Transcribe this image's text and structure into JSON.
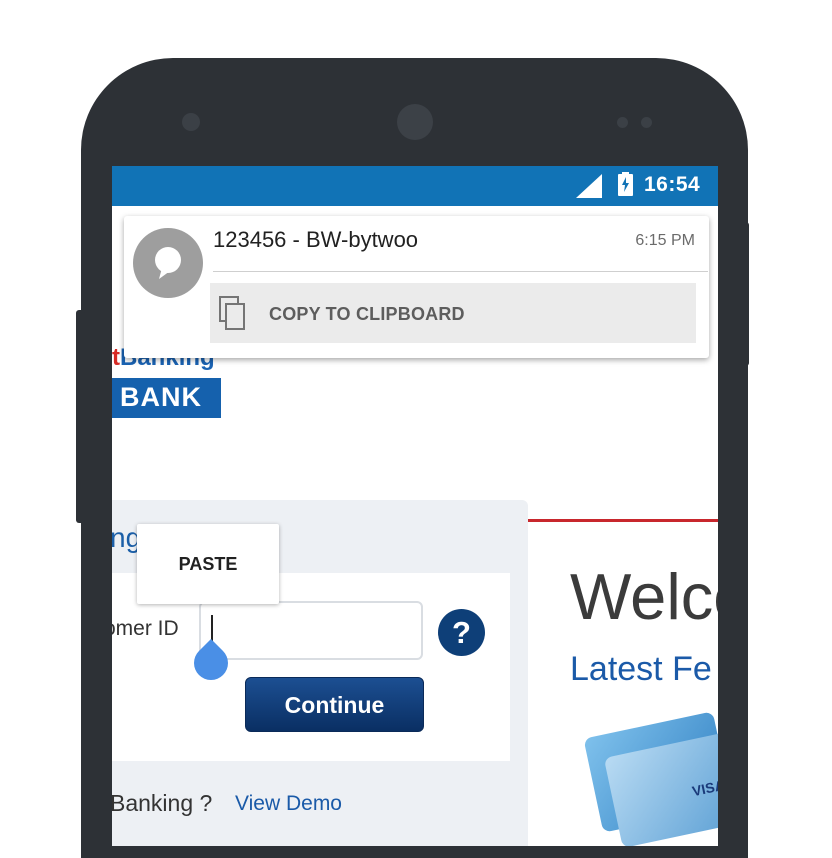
{
  "status_bar": {
    "time": "16:54",
    "icons": [
      "signal-icon",
      "battery-charging-icon"
    ],
    "color": "#1173b6"
  },
  "notification": {
    "title": "123456 - BW-bytwoo",
    "time": "6:15 PM",
    "action_label": "COPY TO CLIPBOARD",
    "icons": [
      "message-bubble-icon",
      "copy-icon"
    ]
  },
  "page": {
    "logo_prefix": "t",
    "logo_word": "Banking",
    "logo_bank": "BANK",
    "login_title": "ng",
    "customer_id_label": "omer ID",
    "customer_id_value": "",
    "help_label": "?",
    "continue_label": "Continue",
    "new_banking_text": "Banking ?",
    "view_demo_label": "View Demo",
    "welcome_text": "Welco",
    "latest_text": "Latest Fe",
    "card_brand": "VISA"
  },
  "context_menu": {
    "paste_label": "PASTE"
  }
}
